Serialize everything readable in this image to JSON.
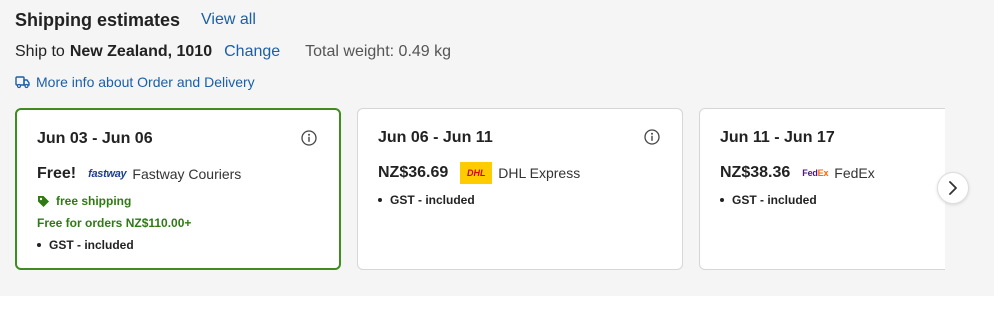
{
  "header": {
    "title": "Shipping estimates",
    "view_all": "View all"
  },
  "ship_to": {
    "label": "Ship to",
    "destination": "New Zealand, 1010",
    "change": "Change",
    "total_weight": "Total weight: 0.49 kg"
  },
  "more_info": {
    "icon": "delivery-truck-icon",
    "label": "More info about Order and Delivery"
  },
  "options": [
    {
      "date": "Jun 03 - Jun 06",
      "price": "Free!",
      "logo_text": "fastway",
      "carrier": "Fastway Couriers",
      "tag": "free shipping",
      "threshold": "Free for orders NZ$110.00+",
      "gst": "GST - included",
      "selected": true,
      "accent": "#3f8c1f"
    },
    {
      "date": "Jun 06 - Jun 11",
      "price": "NZ$36.69",
      "logo_text": "DHL",
      "carrier": "DHL Express",
      "gst": "GST - included",
      "selected": false
    },
    {
      "date": "Jun 11 - Jun 17",
      "price": "NZ$38.36",
      "logo_text": "FedEx",
      "carrier": "FedEx",
      "gst": "GST - included",
      "selected": false
    }
  ],
  "colors": {
    "link": "#1a5fa8",
    "selected_border": "#3f8c1f",
    "free_text": "#2f7a14",
    "dhl_yellow": "#ffcc00",
    "dhl_red": "#d40511",
    "fedex_purple": "#4d148c",
    "fedex_orange": "#ff6600"
  }
}
